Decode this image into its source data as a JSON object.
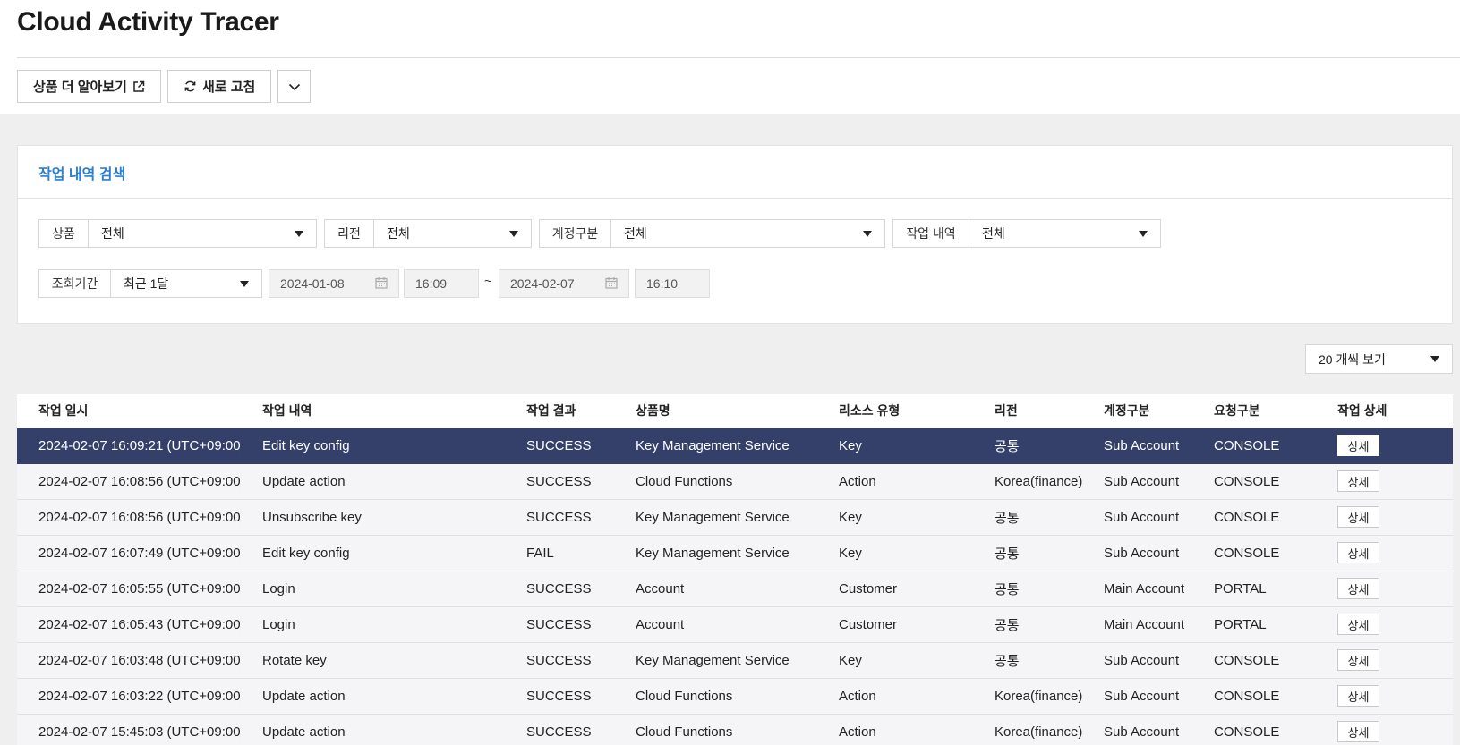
{
  "page": {
    "title": "Cloud Activity Tracer"
  },
  "toolbar": {
    "learn_more": "상품 더 알아보기",
    "refresh": "새로 고침"
  },
  "search": {
    "title": "작업 내역 검색",
    "product": {
      "label": "상품",
      "value": "전체"
    },
    "region": {
      "label": "리전",
      "value": "전체"
    },
    "account_type": {
      "label": "계정구분",
      "value": "전체"
    },
    "activity": {
      "label": "작업 내역",
      "value": "전체"
    },
    "period": {
      "label": "조회기간",
      "value": "최근 1달"
    },
    "start_date": "2024-01-08",
    "start_time": "16:09",
    "separator": "~",
    "end_date": "2024-02-07",
    "end_time": "16:10"
  },
  "page_size": "20 개씩 보기",
  "table": {
    "columns": [
      "작업 일시",
      "작업 내역",
      "작업 결과",
      "상품명",
      "리소스 유형",
      "리전",
      "계정구분",
      "요청구분",
      "작업 상세"
    ],
    "detail_label": "상세",
    "rows": [
      {
        "time": "2024-02-07 16:09:21 (UTC+09:00)",
        "activity": "Edit key config",
        "result": "SUCCESS",
        "product": "Key Management Service",
        "resource": "Key",
        "region": "공통",
        "account": "Sub Account",
        "request": "CONSOLE",
        "selected": true
      },
      {
        "time": "2024-02-07 16:08:56 (UTC+09:00)",
        "activity": "Update action",
        "result": "SUCCESS",
        "product": "Cloud Functions",
        "resource": "Action",
        "region": "Korea(finance)",
        "account": "Sub Account",
        "request": "CONSOLE"
      },
      {
        "time": "2024-02-07 16:08:56 (UTC+09:00)",
        "activity": "Unsubscribe key",
        "result": "SUCCESS",
        "product": "Key Management Service",
        "resource": "Key",
        "region": "공통",
        "account": "Sub Account",
        "request": "CONSOLE"
      },
      {
        "time": "2024-02-07 16:07:49 (UTC+09:00)",
        "activity": "Edit key config",
        "result": "FAIL",
        "product": "Key Management Service",
        "resource": "Key",
        "region": "공통",
        "account": "Sub Account",
        "request": "CONSOLE"
      },
      {
        "time": "2024-02-07 16:05:55 (UTC+09:00)",
        "activity": "Login",
        "result": "SUCCESS",
        "product": "Account",
        "resource": "Customer",
        "region": "공통",
        "account": "Main Account",
        "request": "PORTAL"
      },
      {
        "time": "2024-02-07 16:05:43 (UTC+09:00)",
        "activity": "Login",
        "result": "SUCCESS",
        "product": "Account",
        "resource": "Customer",
        "region": "공통",
        "account": "Main Account",
        "request": "PORTAL"
      },
      {
        "time": "2024-02-07 16:03:48 (UTC+09:00)",
        "activity": "Rotate key",
        "result": "SUCCESS",
        "product": "Key Management Service",
        "resource": "Key",
        "region": "공통",
        "account": "Sub Account",
        "request": "CONSOLE"
      },
      {
        "time": "2024-02-07 16:03:22 (UTC+09:00)",
        "activity": "Update action",
        "result": "SUCCESS",
        "product": "Cloud Functions",
        "resource": "Action",
        "region": "Korea(finance)",
        "account": "Sub Account",
        "request": "CONSOLE"
      },
      {
        "time": "2024-02-07 15:45:03 (UTC+09:00)",
        "activity": "Update action",
        "result": "SUCCESS",
        "product": "Cloud Functions",
        "resource": "Action",
        "region": "Korea(finance)",
        "account": "Sub Account",
        "request": "CONSOLE"
      }
    ]
  },
  "colors": {
    "accent": "#2a7fd4",
    "selected_row": "#34406a",
    "background": "#efefef"
  },
  "icons": [
    "external-link-icon",
    "refresh-icon",
    "chevron-down-icon",
    "calendar-icon",
    "dropdown-triangle-icon"
  ]
}
